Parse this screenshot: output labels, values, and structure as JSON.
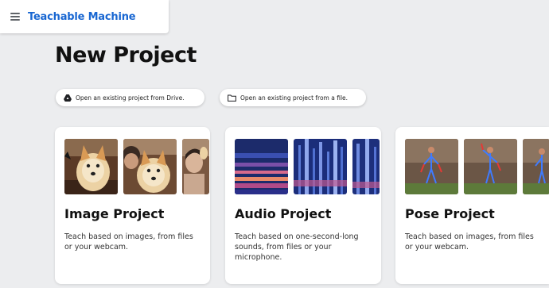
{
  "header": {
    "menu_icon": "hamburger-menu-icon",
    "brand": "Teachable Machine"
  },
  "page": {
    "title": "New Project"
  },
  "actions": {
    "open_drive": {
      "label": "Open an existing project from Drive.",
      "icon": "drive-icon"
    },
    "open_file": {
      "label": "Open an existing project from a file.",
      "icon": "folder-icon"
    }
  },
  "cards": [
    {
      "title": "Image Project",
      "description": "Teach based on images, from files or your webcam."
    },
    {
      "title": "Audio Project",
      "description": "Teach based on one-second-long sounds, from files or your microphone."
    },
    {
      "title": "Pose Project",
      "description": "Teach based on images, from files or your webcam."
    }
  ],
  "colors": {
    "brand": "#1967d2",
    "background": "#ecedef",
    "card": "#ffffff"
  }
}
